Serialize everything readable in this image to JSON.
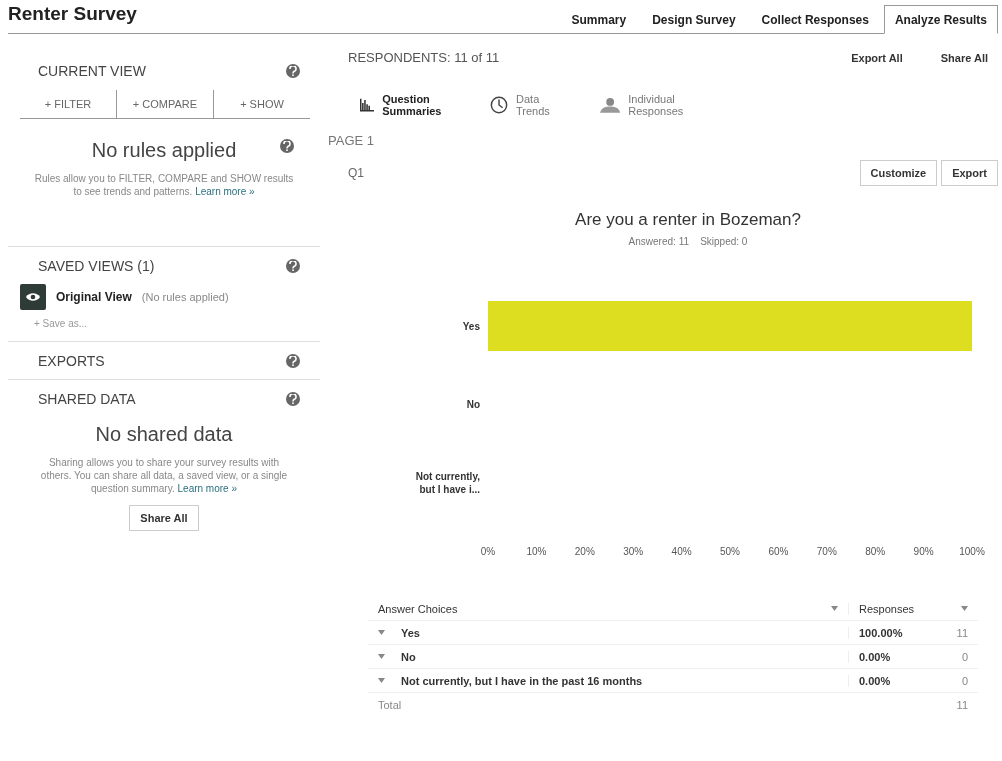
{
  "title": "Renter Survey",
  "tabs": [
    {
      "label": "Summary",
      "selected": false
    },
    {
      "label": "Design Survey",
      "selected": false
    },
    {
      "label": "Collect Responses",
      "selected": false
    },
    {
      "label": "Analyze Results",
      "selected": true
    }
  ],
  "sidebar": {
    "current_view": {
      "heading": "CURRENT VIEW",
      "actions": [
        "+ FILTER",
        "+ COMPARE",
        "+ SHOW"
      ],
      "empty_title": "No rules applied",
      "empty_text": "Rules allow you to FILTER, COMPARE and SHOW results to see trends and patterns.",
      "link": "Learn more »"
    },
    "saved_views": {
      "heading": "SAVED VIEWS (1)",
      "items": [
        {
          "name": "Original View",
          "note": "(No rules applied)"
        }
      ],
      "save_as": "+ Save as..."
    },
    "exports": {
      "heading": "EXPORTS"
    },
    "shared_data": {
      "heading": "SHARED DATA",
      "empty_title": "No shared data",
      "empty_text": "Sharing allows you to share your survey results with others. You can share all data, a saved view, or a single question summary.",
      "link": "Learn more »",
      "button": "Share All"
    }
  },
  "main": {
    "respondents": "RESPONDENTS: 11 of 11",
    "actions": [
      "Export All",
      "Share All"
    ],
    "views": [
      {
        "kind": "chart",
        "label": "Question Summaries",
        "selected": true
      },
      {
        "kind": "clock",
        "label": "Data Trends",
        "selected": false
      },
      {
        "kind": "person",
        "label": "Individual Responses",
        "selected": false
      }
    ],
    "page": "PAGE 1",
    "question_number": "Q1",
    "question_actions": [
      "Customize",
      "Export"
    ],
    "question": "Are you a renter in Bozeman?",
    "stats": "Answered: 11    Skipped: 0",
    "chart_data": {
      "type": "bar",
      "orientation": "horizontal",
      "categories": [
        "Yes",
        "No",
        "Not currently, but I have i..."
      ],
      "series": [
        {
          "color": "#dede20",
          "values": [
            100,
            0,
            0
          ]
        }
      ],
      "xlim": [
        0,
        100
      ],
      "xticks": [
        {
          "value": 0,
          "label": "0%"
        },
        {
          "value": 10,
          "label": "10%"
        },
        {
          "value": 20,
          "label": "20%"
        },
        {
          "value": 30,
          "label": "30%"
        },
        {
          "value": 40,
          "label": "40%"
        },
        {
          "value": 50,
          "label": "50%"
        },
        {
          "value": 60,
          "label": "60%"
        },
        {
          "value": 70,
          "label": "70%"
        },
        {
          "value": 80,
          "label": "80%"
        },
        {
          "value": 90,
          "label": "90%"
        },
        {
          "value": 100,
          "label": "100%"
        }
      ]
    },
    "table": {
      "columns": [
        "Answer Choices",
        "Responses"
      ],
      "rows": [
        {
          "choice": "Yes",
          "percent": "100.00%",
          "count": "11"
        },
        {
          "choice": "No",
          "percent": "0.00%",
          "count": "0"
        },
        {
          "choice": "Not currently, but I have in the past 16 months",
          "percent": "0.00%",
          "count": "0"
        }
      ],
      "total": {
        "label": "Total",
        "count": "11"
      }
    }
  }
}
